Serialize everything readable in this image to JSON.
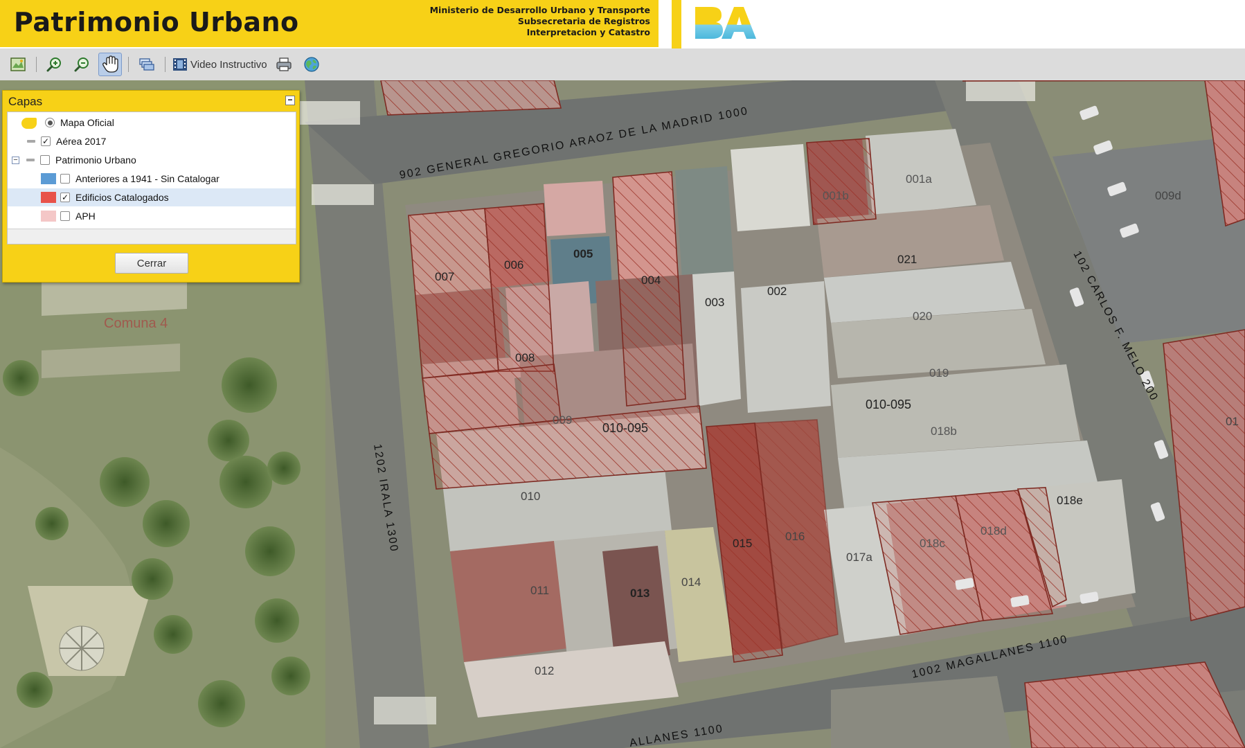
{
  "header": {
    "title": "Patrimonio Urbano",
    "ministry_lines": [
      "Ministerio de Desarrollo Urbano y Transporte",
      "Subsecretaria de Registros",
      "Interpretacion y Catastro"
    ],
    "logo_text": "BA"
  },
  "toolbar": {
    "buttons": [
      {
        "name": "full-extent",
        "icon": "map-extent-icon"
      },
      {
        "name": "zoom-in",
        "icon": "zoom-in-icon"
      },
      {
        "name": "zoom-out",
        "icon": "zoom-out-icon"
      },
      {
        "name": "pan",
        "icon": "hand-icon",
        "active": true
      },
      {
        "name": "layers",
        "icon": "layers-icon"
      }
    ],
    "video_label": "Video Instructivo",
    "print_icon": "printer-icon",
    "globe_icon": "globe-icon"
  },
  "capas": {
    "title": "Capas",
    "collapse_symbol": "−",
    "layers": [
      {
        "label": "Mapa Oficial",
        "control": "radio",
        "checked": true
      },
      {
        "label": "Aérea 2017",
        "control": "checkbox",
        "checked": true
      },
      {
        "label": "Patrimonio Urbano",
        "control": "checkbox",
        "checked": false,
        "expandable": true
      },
      {
        "label": "Anteriores a 1941 - Sin Catalogar",
        "control": "checkbox",
        "checked": false,
        "swatch": "#5b9bd5"
      },
      {
        "label": "Edificios Catalogados",
        "control": "checkbox",
        "checked": true,
        "swatch": "#e8524a",
        "selected": true
      },
      {
        "label": "APH",
        "control": "checkbox",
        "checked": false,
        "swatch": "#f4c7c7"
      }
    ],
    "close_label": "Cerrar"
  },
  "map": {
    "streets": [
      "902 GENERAL GREGORIO ARAOZ DE LA MADRID 1000",
      "1202 IRALA 1300",
      "102 CARLOS F. MELO 200",
      "1002 MAGALLANES 1100",
      "ALLANES 1100"
    ],
    "district_label": "Comuna 4",
    "parcels": [
      "007",
      "006",
      "005",
      "004",
      "003",
      "002",
      "001b",
      "001a",
      "009d",
      "021",
      "020",
      "019",
      "008",
      "009",
      "010-095",
      "010-095",
      "018b",
      "010",
      "015",
      "016",
      "017a",
      "018c",
      "018d",
      "018e",
      "011",
      "013",
      "014",
      "012",
      "01"
    ],
    "colors": {
      "accent": "#f7d117",
      "catalogued": "#e8524a",
      "pre1941": "#5b9bd5",
      "aph": "#f4c7c7"
    }
  }
}
